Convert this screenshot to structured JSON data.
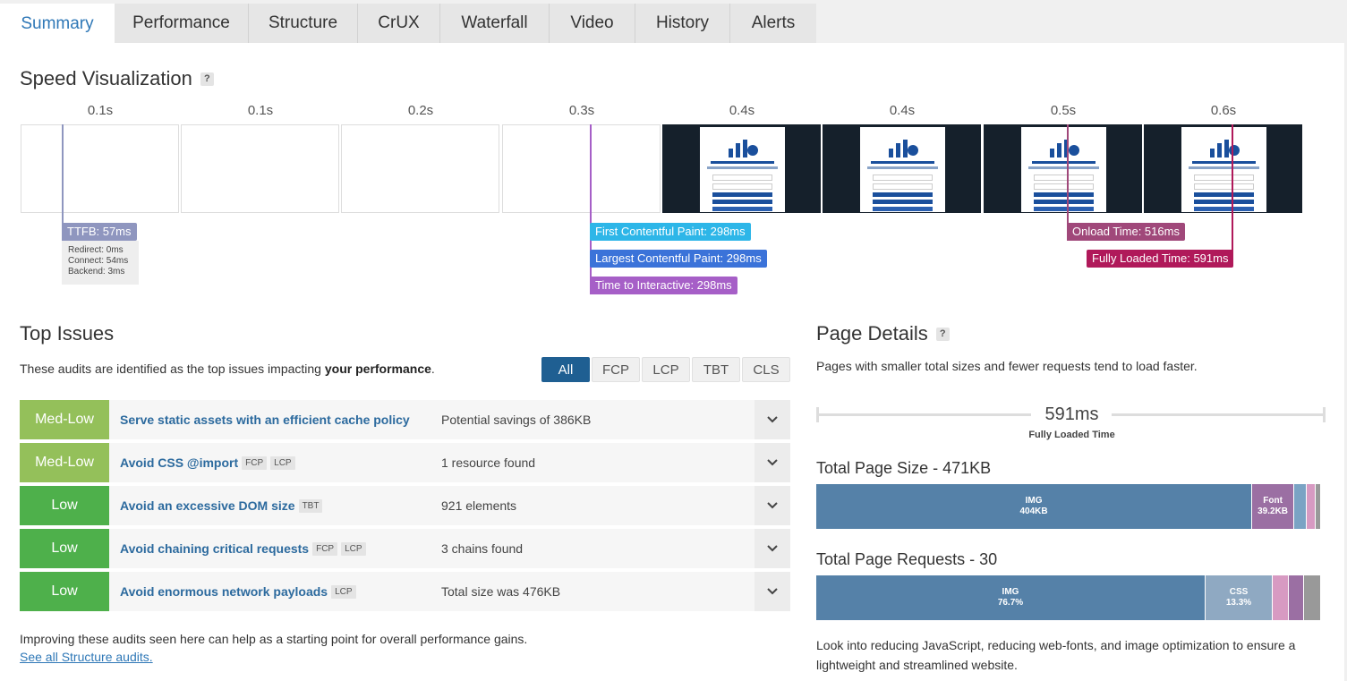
{
  "tabs": [
    "Summary",
    "Performance",
    "Structure",
    "CrUX",
    "Waterfall",
    "Video",
    "History",
    "Alerts"
  ],
  "speed": {
    "title": "Speed Visualization",
    "help": "?",
    "ticks": [
      "0.1s",
      "0.1s",
      "0.2s",
      "0.3s",
      "0.4s",
      "0.4s",
      "0.5s",
      "0.6s"
    ],
    "ttfb": {
      "label": "TTFB: 57ms",
      "redirect": "Redirect: 0ms",
      "connect": "Connect: 54ms",
      "backend": "Backend: 3ms"
    },
    "fcp": "First Contentful Paint: 298ms",
    "lcp": "Largest Contentful Paint: 298ms",
    "tti": "Time to Interactive: 298ms",
    "onload": "Onload Time: 516ms",
    "fully_loaded": "Fully Loaded Time: 591ms",
    "colors": {
      "ttfb": "#8f96bf",
      "fcp": "#2db6e8",
      "lcp": "#3b73d9",
      "tti": "#a65fc7",
      "onload": "#a0487a",
      "fully": "#b0195a"
    }
  },
  "issues": {
    "title": "Top Issues",
    "desc_prefix": "These audits are identified as the top issues impacting ",
    "desc_bold": "your performance",
    "desc_suffix": ".",
    "filters": [
      "All",
      "FCP",
      "LCP",
      "TBT",
      "CLS"
    ],
    "rows": [
      {
        "severity": "Med-Low",
        "title": "Serve static assets with an efficient cache policy",
        "tags": [],
        "value": "Potential savings of 386KB"
      },
      {
        "severity": "Med-Low",
        "title": "Avoid CSS @import",
        "tags": [
          "FCP",
          "LCP"
        ],
        "value": "1 resource found"
      },
      {
        "severity": "Low",
        "title": "Avoid an excessive DOM size",
        "tags": [
          "TBT"
        ],
        "value": "921 elements"
      },
      {
        "severity": "Low",
        "title": "Avoid chaining critical requests",
        "tags": [
          "FCP",
          "LCP"
        ],
        "value": "3 chains found"
      },
      {
        "severity": "Low",
        "title": "Avoid enormous network payloads",
        "tags": [
          "LCP"
        ],
        "value": "Total size was 476KB"
      }
    ],
    "footer": "Improving these audits seen here can help as a starting point for overall performance gains.",
    "link": "See all Structure audits."
  },
  "details": {
    "title": "Page Details",
    "help": "?",
    "desc": "Pages with smaller total sizes and fewer requests tend to load faster.",
    "fully_loaded_value": "591ms",
    "fully_loaded_label": "Fully Loaded Time",
    "size_title": "Total Page Size - 471KB",
    "size_segments": [
      {
        "label": "IMG",
        "value": "404KB",
        "share": 0.865,
        "color": "#5581a8"
      },
      {
        "label": "Font",
        "value": "39.2KB",
        "share": 0.083,
        "color": "#9b6fa3"
      },
      {
        "label": "",
        "value": "",
        "share": 0.025,
        "color": "#7aa3c4"
      },
      {
        "label": "",
        "value": "",
        "share": 0.017,
        "color": "#d79ac2"
      },
      {
        "label": "",
        "value": "",
        "share": 0.01,
        "color": "#999999"
      }
    ],
    "req_title": "Total Page Requests - 30",
    "req_segments": [
      {
        "label": "IMG",
        "value": "76.7%",
        "share": 0.772,
        "color": "#5581a8"
      },
      {
        "label": "CSS",
        "value": "13.3%",
        "share": 0.133,
        "color": "#8fa9c2"
      },
      {
        "label": "",
        "value": "",
        "share": 0.032,
        "color": "#d79ac2"
      },
      {
        "label": "",
        "value": "",
        "share": 0.03,
        "color": "#9b6fa3"
      },
      {
        "label": "",
        "value": "",
        "share": 0.033,
        "color": "#999999"
      }
    ],
    "footer": "Look into reducing JavaScript, reducing web-fonts, and image optimization to ensure a lightweight and streamlined website."
  }
}
